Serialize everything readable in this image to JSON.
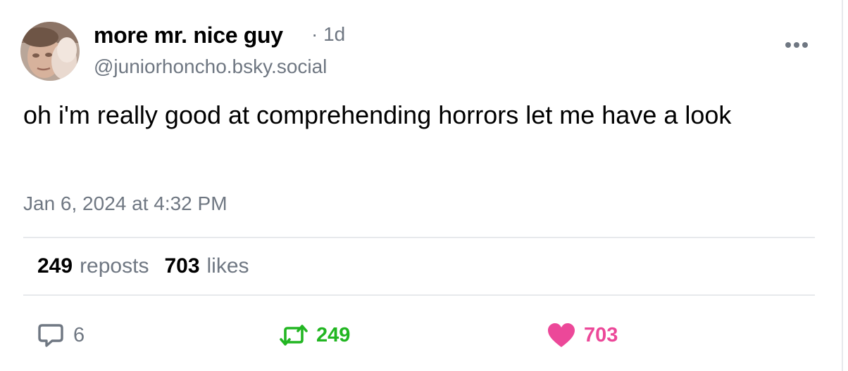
{
  "post": {
    "author": {
      "display_name": "more mr. nice guy",
      "handle": "@juniorhoncho.bsky.social",
      "age": "· 1d"
    },
    "text": "oh i'm really good at comprehending horrors let me have a look",
    "timestamp": "Jan 6, 2024 at 4:32 PM"
  },
  "stats": {
    "reposts_count": "249",
    "reposts_label": "reposts",
    "likes_count": "703",
    "likes_label": "likes"
  },
  "actions": {
    "reply_count": "6",
    "repost_count": "249",
    "like_count": "703"
  },
  "icons": {
    "more": "more-horizontal-icon",
    "reply": "speech-bubble-icon",
    "repost": "repost-arrows-icon",
    "like": "heart-icon"
  },
  "colors": {
    "muted_text": "#6f7782",
    "repost_green": "#22b622",
    "like_pink": "#ec4899",
    "divider": "#e7e9ec"
  }
}
